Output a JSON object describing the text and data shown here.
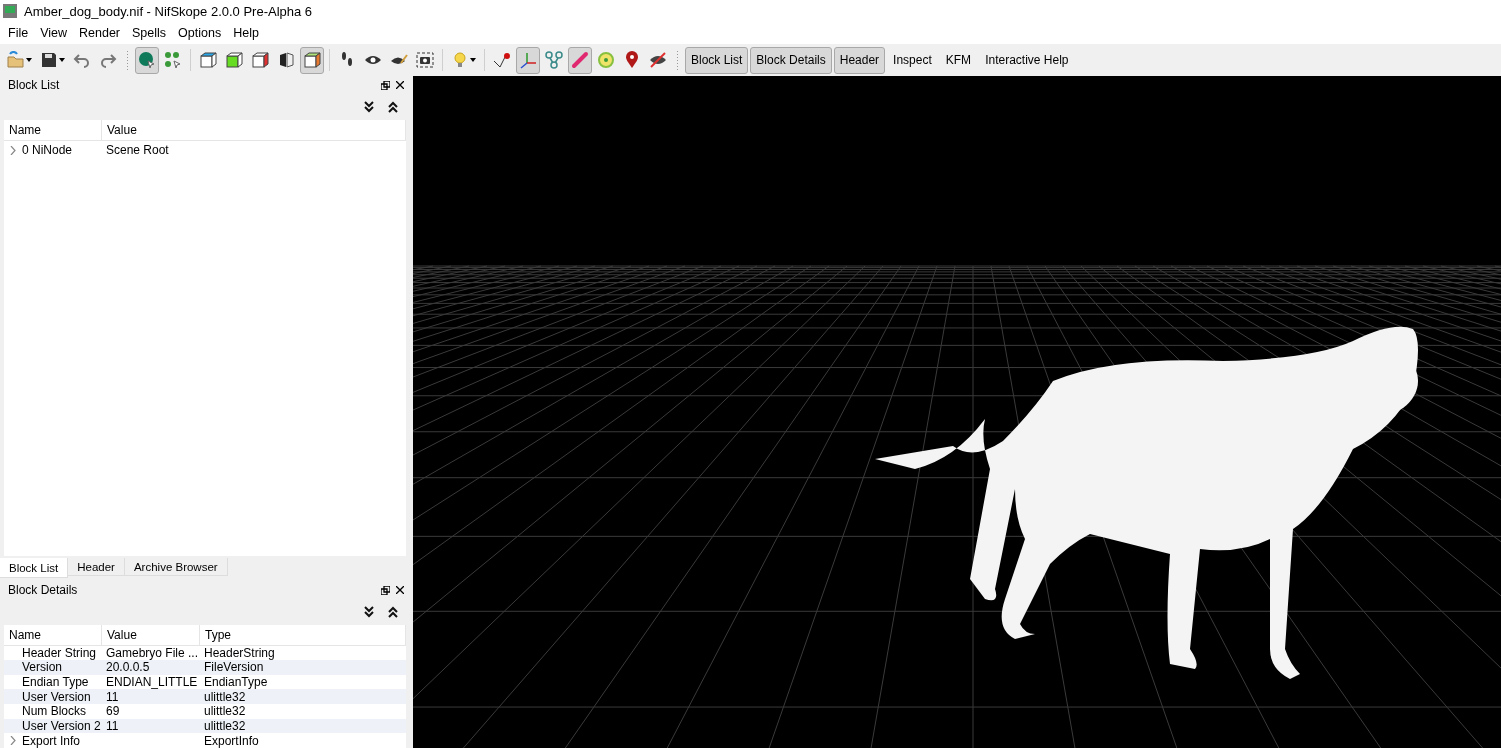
{
  "window": {
    "title": "Amber_dog_body.nif - NifSkope 2.0.0 Pre-Alpha 6"
  },
  "menu": [
    "File",
    "View",
    "Render",
    "Spells",
    "Options",
    "Help"
  ],
  "toolbar": {
    "tools": [
      {
        "kind": "open",
        "pressed": false
      },
      {
        "kind": "save",
        "pressed": false
      },
      {
        "kind": "undo",
        "pressed": false
      },
      {
        "kind": "redo",
        "pressed": false
      },
      {
        "kind": "grip"
      },
      {
        "kind": "sphere",
        "pressed": true
      },
      {
        "kind": "dots",
        "pressed": false
      },
      {
        "kind": "sep"
      },
      {
        "kind": "cube-blue",
        "pressed": false
      },
      {
        "kind": "cube-green",
        "pressed": false
      },
      {
        "kind": "cube-red",
        "pressed": false
      },
      {
        "kind": "mirror",
        "pressed": false
      },
      {
        "kind": "cube-color",
        "pressed": true
      },
      {
        "kind": "sep"
      },
      {
        "kind": "footprints",
        "pressed": false
      },
      {
        "kind": "eye",
        "pressed": false
      },
      {
        "kind": "eye-pen",
        "pressed": false
      },
      {
        "kind": "camera",
        "pressed": false
      },
      {
        "kind": "sep"
      },
      {
        "kind": "bulb",
        "pressed": false
      },
      {
        "kind": "sep"
      },
      {
        "kind": "point",
        "pressed": false
      },
      {
        "kind": "axes",
        "pressed": true
      },
      {
        "kind": "nodes",
        "pressed": false
      },
      {
        "kind": "bone",
        "pressed": true
      },
      {
        "kind": "target",
        "pressed": false
      },
      {
        "kind": "pin",
        "pressed": false
      },
      {
        "kind": "eye-off",
        "pressed": false
      },
      {
        "kind": "grip"
      }
    ],
    "toggles": [
      {
        "label": "Block List",
        "on": true
      },
      {
        "label": "Block Details",
        "on": true
      },
      {
        "label": "Header",
        "on": true
      },
      {
        "label": "Inspect",
        "on": false
      },
      {
        "label": "KFM",
        "on": false
      },
      {
        "label": "Interactive Help",
        "on": false
      }
    ]
  },
  "block_list": {
    "title": "Block List",
    "columns": [
      "Name",
      "Value"
    ],
    "rows": [
      {
        "name": "0 NiNode",
        "value": "Scene Root",
        "expanded": false
      }
    ]
  },
  "dock_tabs": [
    {
      "label": "Block List",
      "selected": true
    },
    {
      "label": "Header",
      "selected": false
    },
    {
      "label": "Archive Browser",
      "selected": false
    }
  ],
  "block_details": {
    "title": "Block Details",
    "columns": [
      "Name",
      "Value",
      "Type"
    ],
    "rows": [
      {
        "name": "Header String",
        "value": "Gamebryo File ...",
        "type": "HeaderString",
        "expandable": false
      },
      {
        "name": "Version",
        "value": "20.0.0.5",
        "type": "FileVersion",
        "expandable": false
      },
      {
        "name": "Endian Type",
        "value": "ENDIAN_LITTLE",
        "type": "EndianType",
        "expandable": false
      },
      {
        "name": "User Version",
        "value": "11",
        "type": "ulittle32",
        "expandable": false
      },
      {
        "name": "Num Blocks",
        "value": "69",
        "type": "ulittle32",
        "expandable": false
      },
      {
        "name": "User Version 2",
        "value": "11",
        "type": "ulittle32",
        "expandable": false
      },
      {
        "name": "Export Info",
        "value": "",
        "type": "ExportInfo",
        "expandable": true
      }
    ]
  }
}
